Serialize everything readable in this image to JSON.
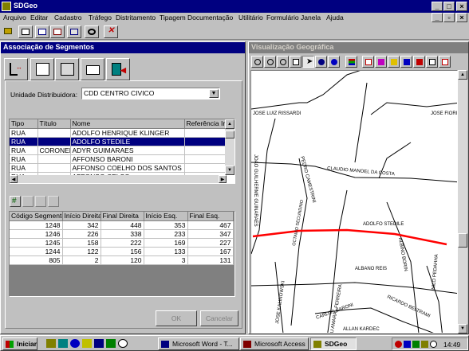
{
  "window": {
    "title": "SDGeo"
  },
  "menu": [
    "Arquivo",
    "Editar",
    "Cadastro",
    "Tráfego",
    "Distritamento",
    "Tipagem",
    "Documentação",
    "Utilitário",
    "Formulário",
    "Janela",
    "Ajuda"
  ],
  "left_panel": {
    "title": "Associação de Segmentos",
    "unit_label": "Unidade Distribuidora:",
    "unit_value": "CDD CENTRO CIVICO",
    "streets": {
      "headers": [
        "Tipo",
        "Título",
        "Nome",
        "Referência Ir"
      ],
      "rows": [
        [
          "RUA",
          "",
          "ADOLFO HENRIQUE KLINGER",
          ""
        ],
        [
          "RUA",
          "",
          "ADOLFO STEDILE",
          ""
        ],
        [
          "RUA",
          "CORONEL",
          "ADYR GUIMARAES",
          ""
        ],
        [
          "RUA",
          "",
          "AFFONSO BARONI",
          ""
        ],
        [
          "RUA",
          "",
          "AFFONSO COELHO DOS SANTOS",
          ""
        ],
        [
          "RUA",
          "",
          "AFFONSO CELSO",
          ""
        ]
      ],
      "selected_index": 1
    },
    "segments": {
      "headers": [
        "Código Segmento",
        "Início Direita",
        "Final Direita",
        "Início Esq.",
        "Final Esq."
      ],
      "rows": [
        [
          "1248",
          "342",
          "448",
          "353",
          "467"
        ],
        [
          "1246",
          "226",
          "338",
          "233",
          "347"
        ],
        [
          "1245",
          "158",
          "222",
          "169",
          "227"
        ],
        [
          "1244",
          "122",
          "156",
          "133",
          "167"
        ],
        [
          "805",
          "2",
          "120",
          "3",
          "131"
        ]
      ]
    },
    "ok_label": "OK",
    "cancel_label": "Cancelar"
  },
  "right_panel": {
    "title": "Visualização Geográfica",
    "streets": {
      "s1": "JOSE LUIZ RISSARDI",
      "s2": "JOSE FIORI",
      "s3": "JOAO GUILHERME GUINARAES",
      "s4": "PEDRO CAMESTRINI",
      "s5": "CLAUDIO MANOEL DA COSTA",
      "s6": "ADOLFO STEDILE",
      "s7": "OCTAVIO SECUNDINO",
      "s8": "ALBINO BORIN",
      "s9": "ALCEU AMARAL FERREIRA",
      "s10": "ALBANO REIS",
      "s11": "JOSE KALINOWSKI",
      "s12": "RICARDO BELTRAMI",
      "s13": "NILO PEDAHHA",
      "s14": "CARLOS BARONI",
      "s15": "ALLAN KARDEC"
    },
    "highlight_color": "#ff0000"
  },
  "taskbar": {
    "start_label": "Iniciar",
    "tasks": [
      "Microsoft Word - T...",
      "Microsoft Access",
      "SDGeo"
    ],
    "clock": "14:49"
  }
}
